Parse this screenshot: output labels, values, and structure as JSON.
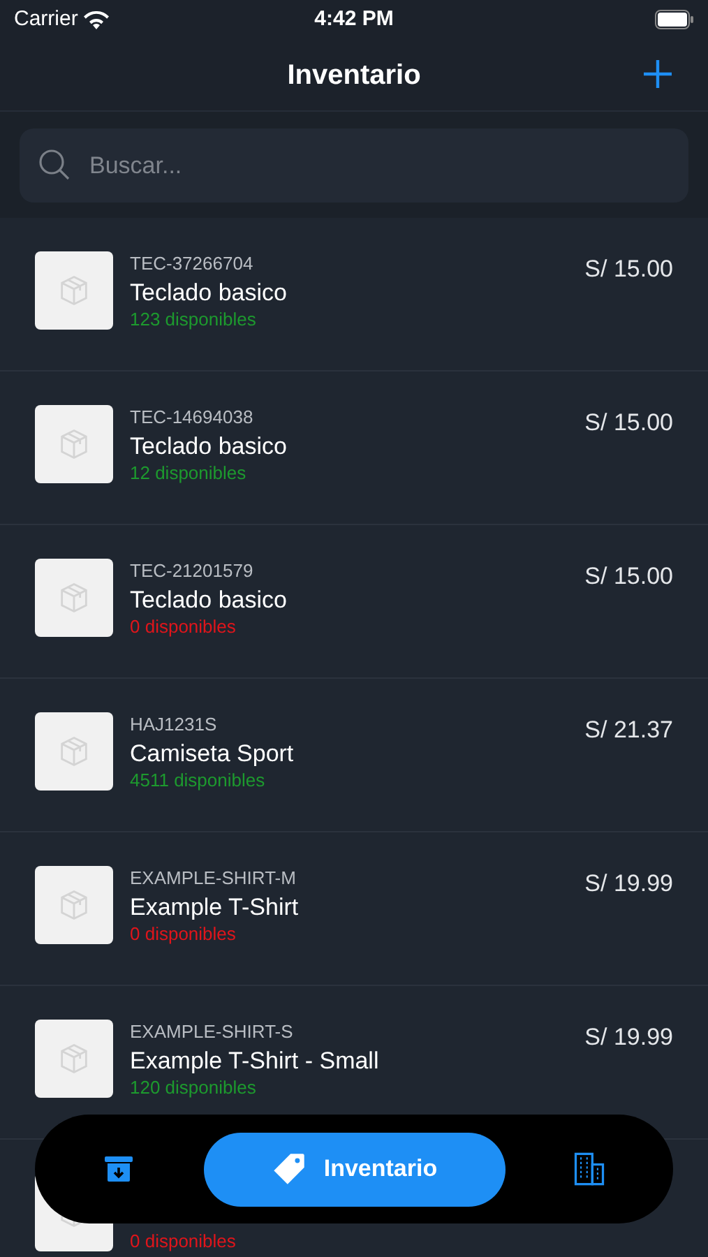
{
  "status_bar": {
    "carrier": "Carrier",
    "time": "4:42 PM"
  },
  "header": {
    "title": "Inventario"
  },
  "search": {
    "placeholder": "Buscar..."
  },
  "products": [
    {
      "sku": "TEC-37266704",
      "name": "Teclado basico",
      "stock": "123 disponibles",
      "available": true,
      "price": "S/ 15.00"
    },
    {
      "sku": "TEC-14694038",
      "name": "Teclado basico",
      "stock": "12 disponibles",
      "available": true,
      "price": "S/ 15.00"
    },
    {
      "sku": "TEC-21201579",
      "name": "Teclado basico",
      "stock": "0 disponibles",
      "available": false,
      "price": "S/ 15.00"
    },
    {
      "sku": "HAJ1231S",
      "name": "Camiseta Sport",
      "stock": "4511 disponibles",
      "available": true,
      "price": "S/ 21.37"
    },
    {
      "sku": "EXAMPLE-SHIRT-M",
      "name": "Example T-Shirt",
      "stock": "0 disponibles",
      "available": false,
      "price": "S/ 19.99"
    },
    {
      "sku": "EXAMPLE-SHIRT-S",
      "name": "Example T-Shirt - Small",
      "stock": "120 disponibles",
      "available": true,
      "price": "S/ 19.99"
    },
    {
      "stock": "0 disponibles",
      "available": false
    }
  ],
  "tab_bar": [
    {
      "kind": "archive",
      "selected": false
    },
    {
      "kind": "tag",
      "label": "Inventario",
      "selected": true
    },
    {
      "kind": "building",
      "selected": false
    }
  ]
}
